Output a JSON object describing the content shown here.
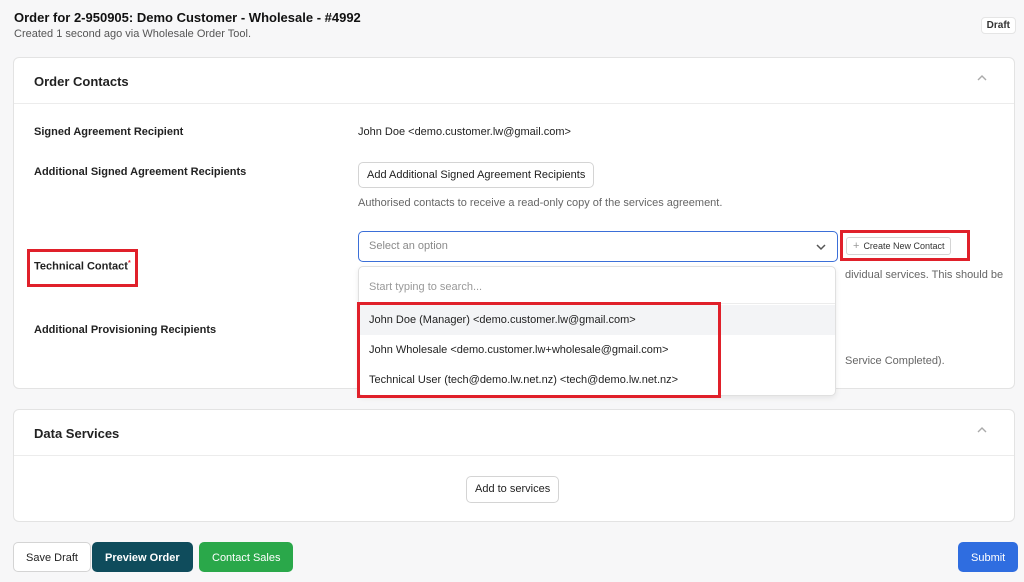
{
  "header": {
    "title": "Order for 2-950905: Demo Customer - Wholesale - #4992",
    "subtitle": "Created 1 second ago via Wholesale Order Tool.",
    "status_badge": "Draft"
  },
  "order_contacts": {
    "title": "Order Contacts",
    "signed_agreement_label": "Signed Agreement Recipient",
    "signed_agreement_value": "John Doe <demo.customer.lw@gmail.com>",
    "additional_signed_label": "Additional Signed Agreement Recipients",
    "additional_signed_button": "Add Additional Signed Agreement Recipients",
    "additional_signed_hint": "Authorised contacts to receive a read-only copy of the services agreement.",
    "technical_contact_label": "Technical Contact",
    "technical_required_mark": "*",
    "technical_select_placeholder": "Select an option",
    "create_contact_button": "Create New Contact",
    "technical_hint_tail": "dividual services. This should be",
    "provisioning_label": "Additional Provisioning Recipients",
    "provisioning_hint_tail": "Service Completed).",
    "dropdown": {
      "search_placeholder": "Start typing to search...",
      "options": [
        "John Doe (Manager) <demo.customer.lw@gmail.com>",
        "John Wholesale <demo.customer.lw+wholesale@gmail.com>",
        "Technical User (tech@demo.lw.net.nz) <tech@demo.lw.net.nz>"
      ]
    }
  },
  "data_services": {
    "title": "Data Services",
    "add_button": "Add to services"
  },
  "footer": {
    "save_draft": "Save Draft",
    "preview_order": "Preview Order",
    "contact_sales": "Contact Sales",
    "submit": "Submit"
  },
  "colors": {
    "annotation_red": "#e0202a",
    "preview_bg": "#0f4c5c",
    "contact_sales_bg": "#2aa84a",
    "submit_bg": "#2f6de0",
    "select_border": "#3b6fd8"
  }
}
